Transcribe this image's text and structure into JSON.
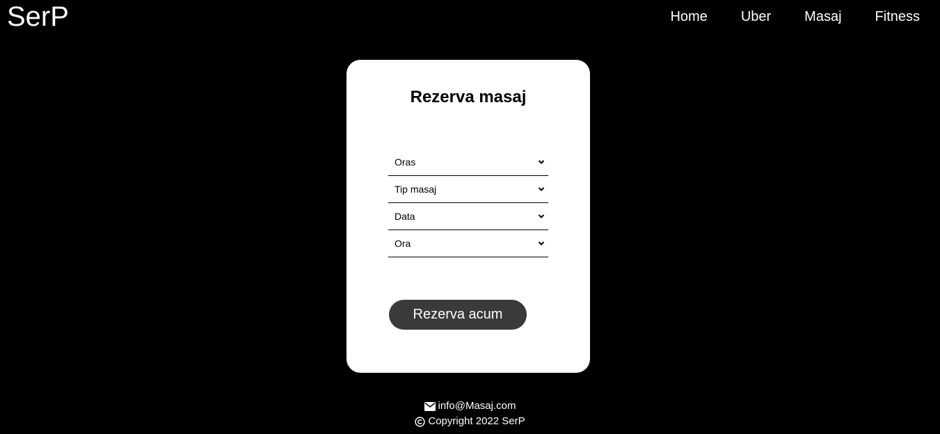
{
  "header": {
    "logo": "SerP",
    "nav": [
      "Home",
      "Uber",
      "Masaj",
      "Fitness"
    ]
  },
  "card": {
    "title": "Rezerva masaj",
    "fields": [
      {
        "label": "Oras",
        "icon": "chevron-down-icon"
      },
      {
        "label": "Tip masaj",
        "icon": "chevron-down-icon"
      },
      {
        "label": "Data",
        "icon": "chevron-down-icon"
      },
      {
        "label": "Ora",
        "icon": "chevron-down-icon"
      }
    ],
    "button": "Rezerva acum"
  },
  "footer": {
    "email": "info@Masaj.com",
    "email_icon": "envelope-icon",
    "copyright": "Copyright 2022 SerP",
    "copyright_icon": "copyright-icon"
  },
  "colors": {
    "background": "#000000",
    "card": "#ffffff",
    "button": "#3a3a3a",
    "text_light": "#ffffff",
    "text_dark": "#000000"
  }
}
